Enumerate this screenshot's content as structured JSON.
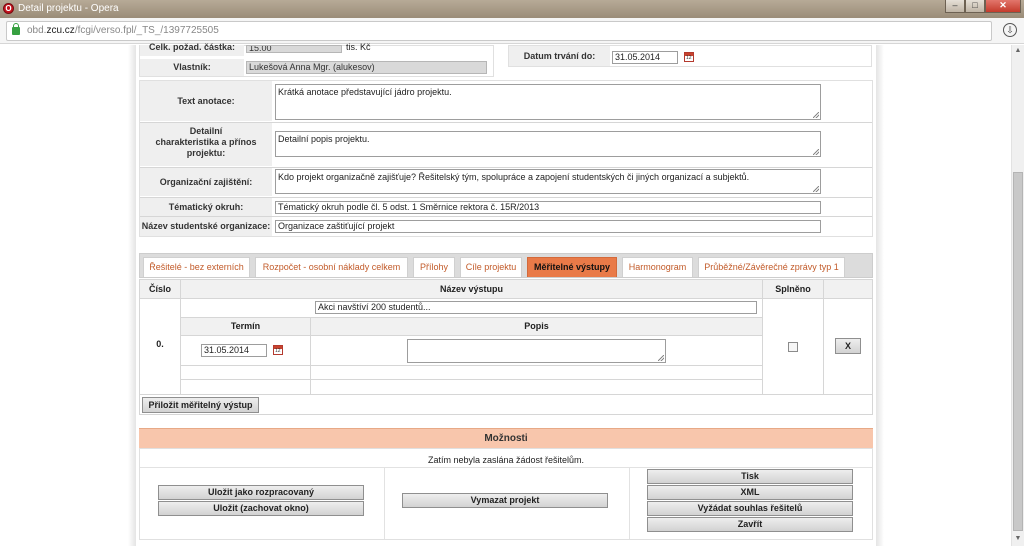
{
  "window": {
    "title": "Detail projektu - Opera",
    "controls": [
      "–",
      "□",
      "✕"
    ]
  },
  "address": {
    "url_prefix": "obd.",
    "url_domain": "zcu.cz",
    "url_path": "/fcgi/verso.fpl/_TS_/1397725505"
  },
  "header": {
    "amount_label": "Celk. požad. částka:",
    "amount_value": "15.00",
    "amount_unit": "tis. Kč",
    "owner_label": "Vlastník:",
    "owner_value": "Lukešová Anna Mgr. (alukesov)",
    "duration_label": "Datum trvání do:",
    "duration_value": "31.05.2014"
  },
  "form": {
    "annotation_label": "Text anotace:",
    "annotation_value": "Krátká anotace představující jádro projektu.",
    "detail_label_1": "Detailní",
    "detail_label_2": "charakteristika a přínos",
    "detail_label_3": "projektu:",
    "detail_value": "Detailní popis projektu.",
    "org_label": "Organizační zajištění:",
    "org_value": "Kdo projekt organizačně zajišťuje? Řešitelský tým, spolupráce a zapojení studentských či jiných organizací a subjektů.",
    "topic_label": "Tématický okruh:",
    "topic_value": "Tématický okruh podle čl. 5 odst. 1 Směrnice rektora č. 15R/2013",
    "studorg_label": "Název studentské organizace:",
    "studorg_value": "Organizace zaštiťující projekt"
  },
  "tabs": [
    {
      "label": "Řešitelé - bez externích"
    },
    {
      "label": "Rozpočet - osobní náklady celkem"
    },
    {
      "label": "Přílohy"
    },
    {
      "label": "Cíle projektu"
    },
    {
      "label": "Měřitelné výstupy"
    },
    {
      "label": "Harmonogram"
    },
    {
      "label": "Průběžné/Závěrečné zprávy typ 1"
    }
  ],
  "outputs": {
    "col_number": "Číslo",
    "col_name": "Název výstupu",
    "col_done": "Splněno",
    "col_term": "Termín",
    "col_desc": "Popis",
    "row_number": "0.",
    "row_name": "Akci navštíví 200 studentů...",
    "row_term": "31.05.2014",
    "row_desc": "",
    "delete_label": "X",
    "attach_label": "Přiložit měřitelný výstup"
  },
  "options": {
    "title": "Možnosti",
    "status": "Zatím nebyla zaslána žádost řešitelům.",
    "save_draft": "Uložit jako rozpracovaný",
    "save_keep": "Uložit (zachovat okno)",
    "delete_project": "Vymazat projekt",
    "print": "Tisk",
    "xml": "XML",
    "request_consent": "Vyžádat souhlas řešitelů",
    "close": "Zavřít"
  },
  "icons": {
    "app": "opera-icon",
    "lock": "lock-icon",
    "download": "download-icon",
    "calendar": "calendar-icon"
  },
  "colors": {
    "accent": "#e97a48",
    "tab_text": "#c25b2a",
    "options_header": "#f8c6ac"
  }
}
